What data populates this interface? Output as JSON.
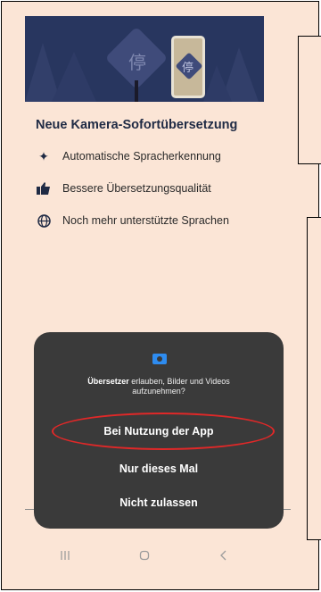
{
  "banner": {
    "sign_char": "停",
    "phone_char": "停"
  },
  "feature_title": "Neue Kamera-Sofortübersetzung",
  "features": [
    {
      "icon": "sparkle-icon",
      "label": "Automatische Spracherkennung"
    },
    {
      "icon": "thumbs-up-icon",
      "label": "Bessere Übersetzungsqualität"
    },
    {
      "icon": "globe-icon",
      "label": "Noch mehr unterstützte Sprachen"
    }
  ],
  "dialog": {
    "app_name": "Übersetzer",
    "prompt_rest": " erlauben, Bilder und Videos aufzunehmen?",
    "options": [
      "Bei Nutzung der App",
      "Nur dieses Mal",
      "Nicht zulassen"
    ]
  },
  "colors": {
    "background": "#fbe5d6",
    "banner": "#28365f",
    "dialog": "#3a3a3a",
    "highlight": "#e02828",
    "camera_icon": "#2e8cf0"
  }
}
